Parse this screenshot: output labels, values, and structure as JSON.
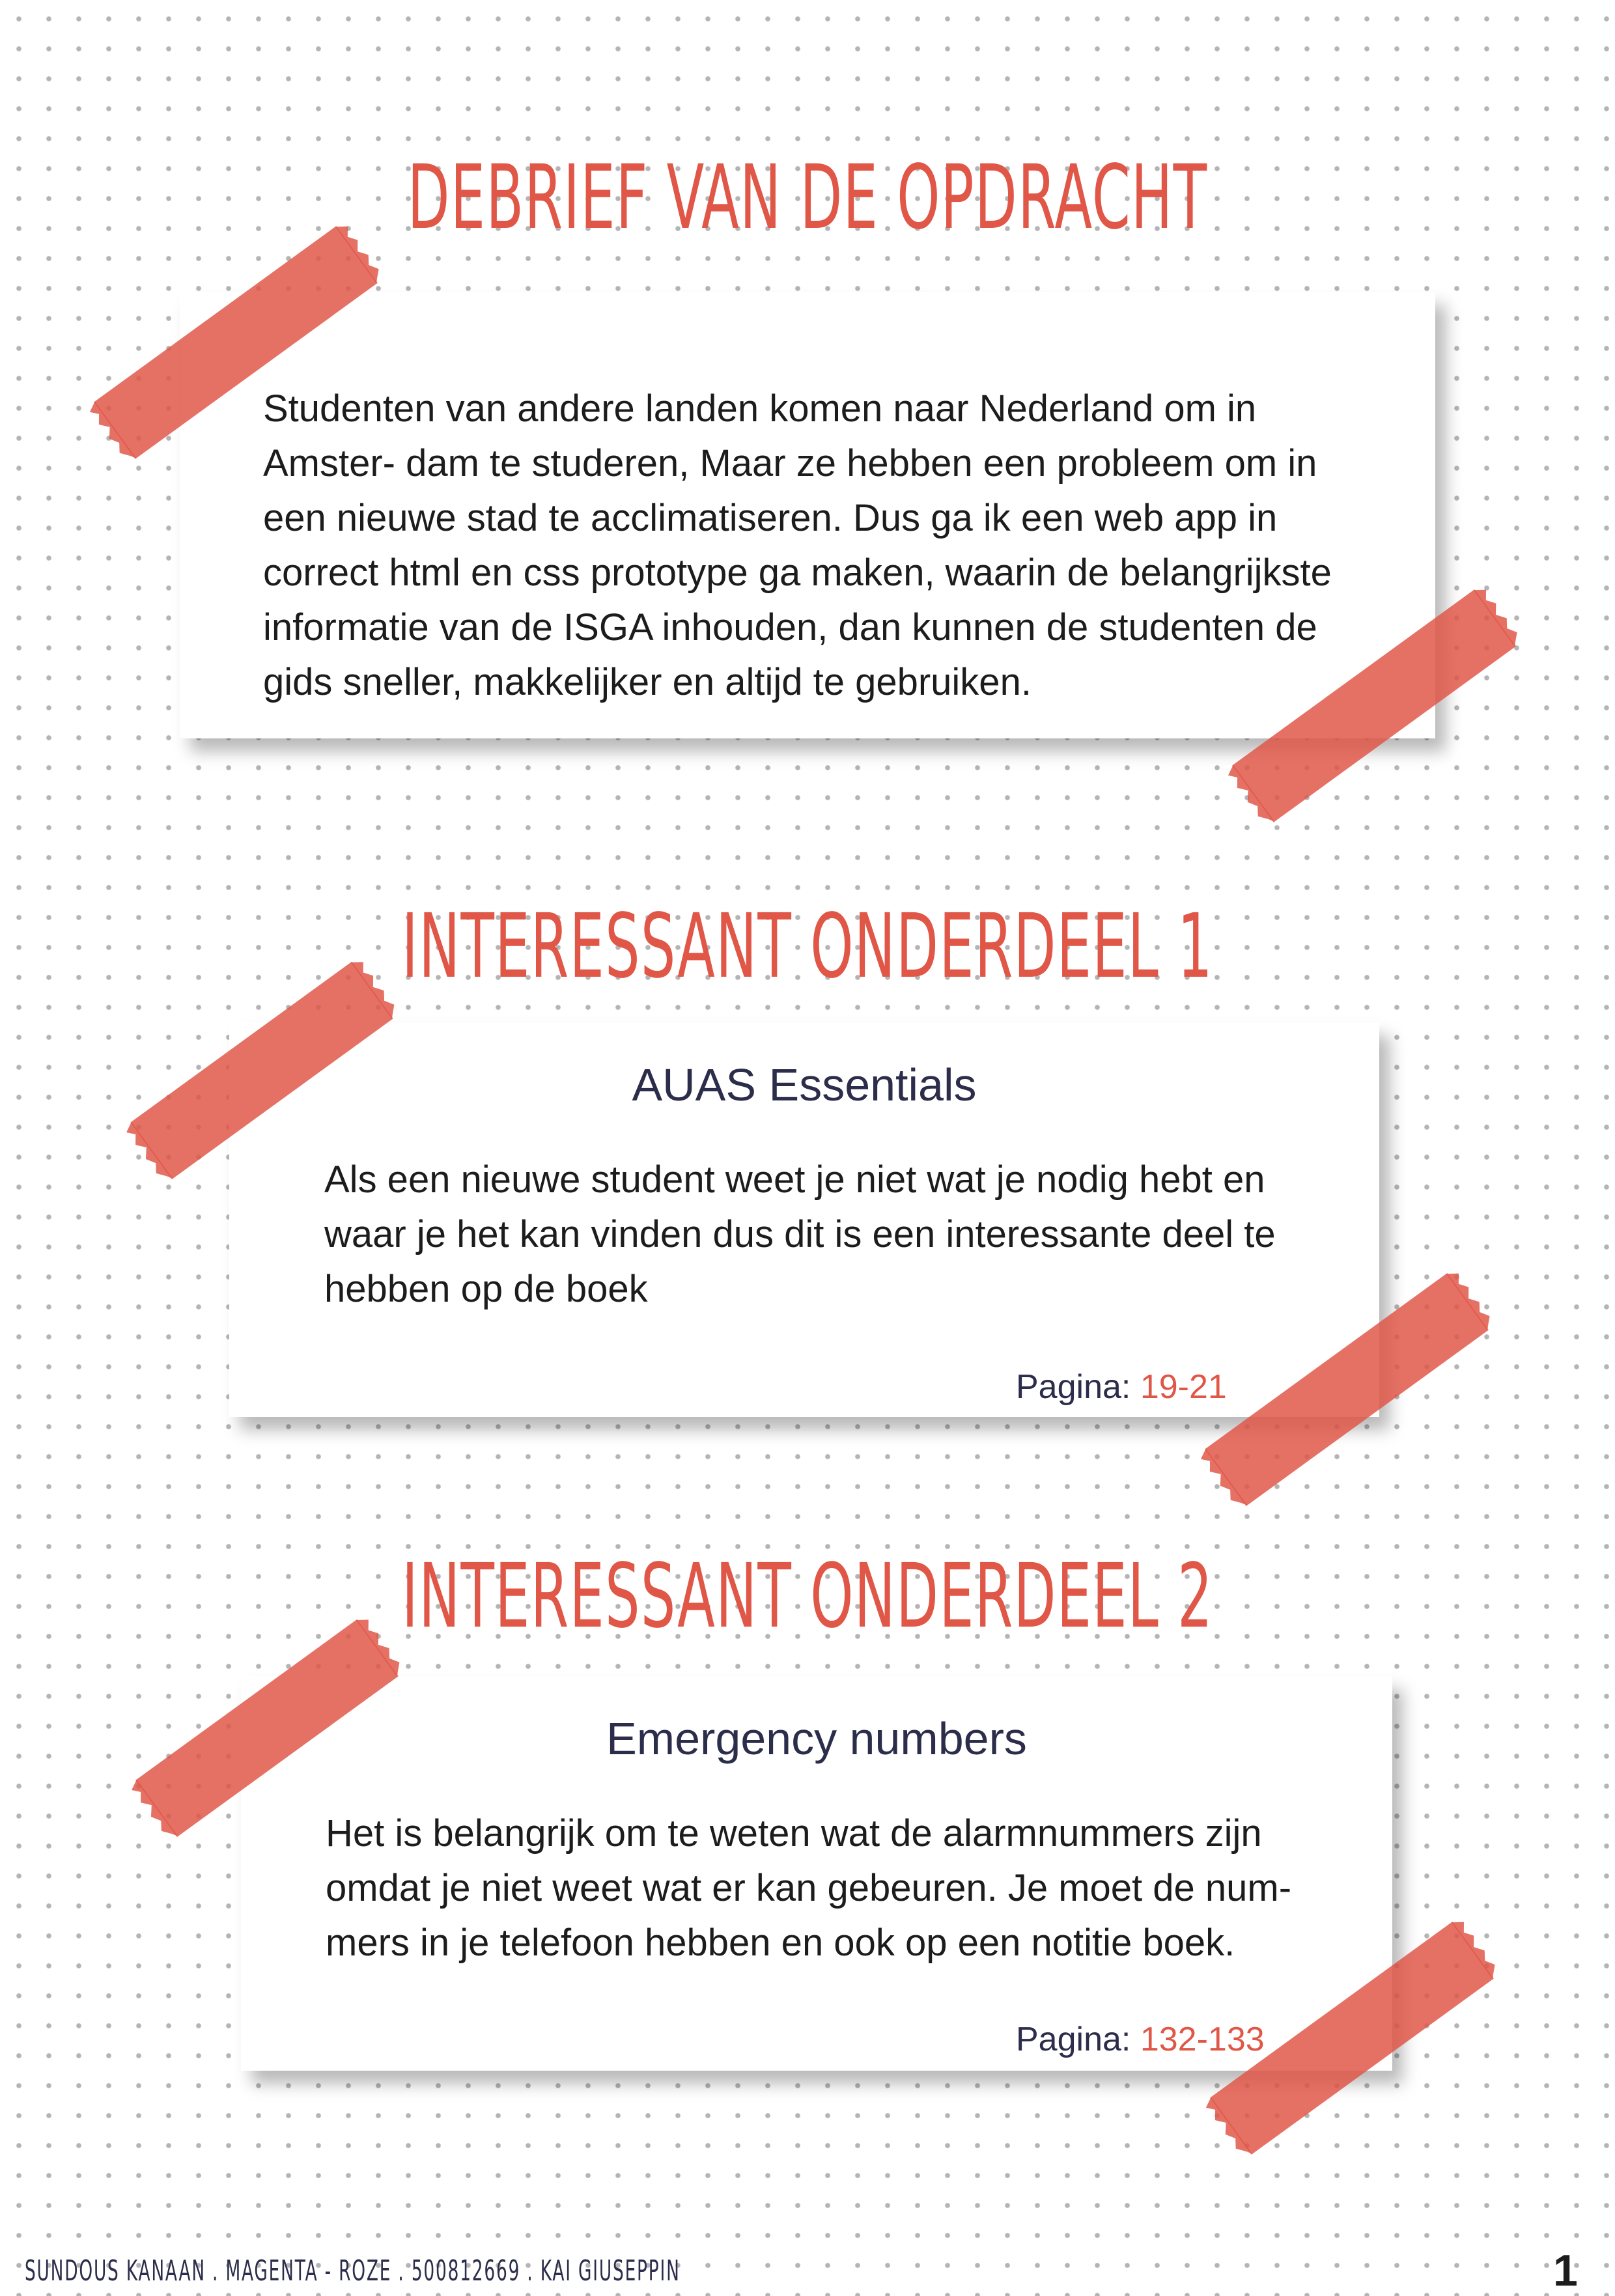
{
  "sections": [
    {
      "heading": "DEBRIEF VAN DE OPDRACHT",
      "body": "Studenten van andere landen komen naar Nederland om in Amster- dam te studeren, Maar ze hebben een probleem om in een nieuwe stad te acclimatiseren. Dus ga ik een web app in correct html en css prototype ga maken, waarin de belangrijkste informatie van de ISGA inhouden, dan kunnen de studenten de gids sneller, makkelijker en altijd te gebruiken."
    },
    {
      "heading": "INTERESSANT ONDERDEEL 1",
      "subtitle": "AUAS Essentials",
      "body": "Als een nieuwe student weet je niet wat je nodig hebt en waar je het kan vinden dus dit is een interessante deel te hebben op de boek",
      "page_label": "Pagina:",
      "page_range": "19-21"
    },
    {
      "heading": "INTERESSANT ONDERDEEL 2",
      "subtitle": "Emergency numbers",
      "body": "Het is belangrijk om te weten wat de alarmnummers zijn omdat je niet weet wat er kan gebeuren. Je moet de num- mers in je telefoon hebben en ook op een notitie boek.",
      "page_label": "Pagina:",
      "page_range": "132-133"
    }
  ],
  "footer": "SUNDOUS KANAAN . MAGENTA - ROZE . 500812669 . KAI GIUSEPPIN",
  "page_number": "1",
  "colors": {
    "accent": "#e05647",
    "navy": "#2b2d4a",
    "dots": "#b4b4b4"
  }
}
